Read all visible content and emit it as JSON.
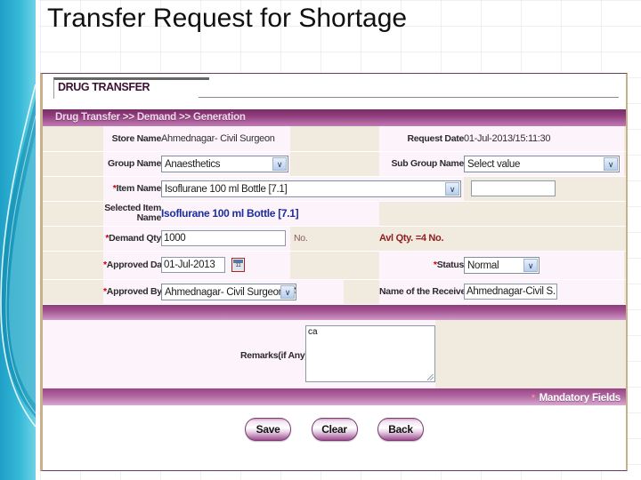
{
  "slide": {
    "title": "Transfer Request for Shortage"
  },
  "app": {
    "tab_title": "DRUG TRANSFER",
    "breadcrumb": "Drug Transfer >> Demand >> Generation"
  },
  "form": {
    "store_name_label": "Store Name",
    "store_name_value": "Ahmednagar- Civil Surgeon",
    "request_date_label": "Request Date",
    "request_date_value": "01-Jul-2013/15:11:30",
    "group_name_label": "Group Name",
    "group_name_value": "Anaesthetics",
    "sub_group_name_label": "Sub Group Name",
    "sub_group_name_value": "Select value",
    "item_name_label": "Item Name",
    "item_name_value": "Isoflurane 100 ml Bottle [7.1]",
    "item_extra_value": "",
    "selected_item_label_1": "Selected Item",
    "selected_item_label_2": "Name",
    "selected_item_value": "Isoflurane 100 ml Bottle [7.1]",
    "demand_qty_label": "Demand Qty",
    "demand_qty_value": "1000",
    "demand_qty_unit": "No.",
    "avl_qty_text": "Avl Qty. =4 No.",
    "approved_date_label": "Approved Date",
    "approved_date_value": "01-Jul-2013",
    "status_label": "Status",
    "status_value": "Normal",
    "approved_by_label": "Approved By",
    "approved_by_value": "Ahmednagar- Civil Surgeon - Ahmednagar",
    "receiver_label": "Name of the Receiver",
    "receiver_value": "Ahmednagar-Civil S.",
    "remarks_label": "Remarks(if Any)",
    "remarks_value": "ca",
    "mandatory_star": "*",
    "mandatory_text": "Mandatory Fields"
  },
  "buttons": {
    "save": "Save",
    "clear": "Clear",
    "back": "Back"
  },
  "icons": {
    "dropdown_arrow": "∨",
    "calendar": "calendar-icon"
  },
  "colors": {
    "accent_purple": "#8e3a79",
    "band_cyan": "#29aed0",
    "selected_item_blue": "#1a2f9e",
    "required_red": "#cc0000"
  }
}
